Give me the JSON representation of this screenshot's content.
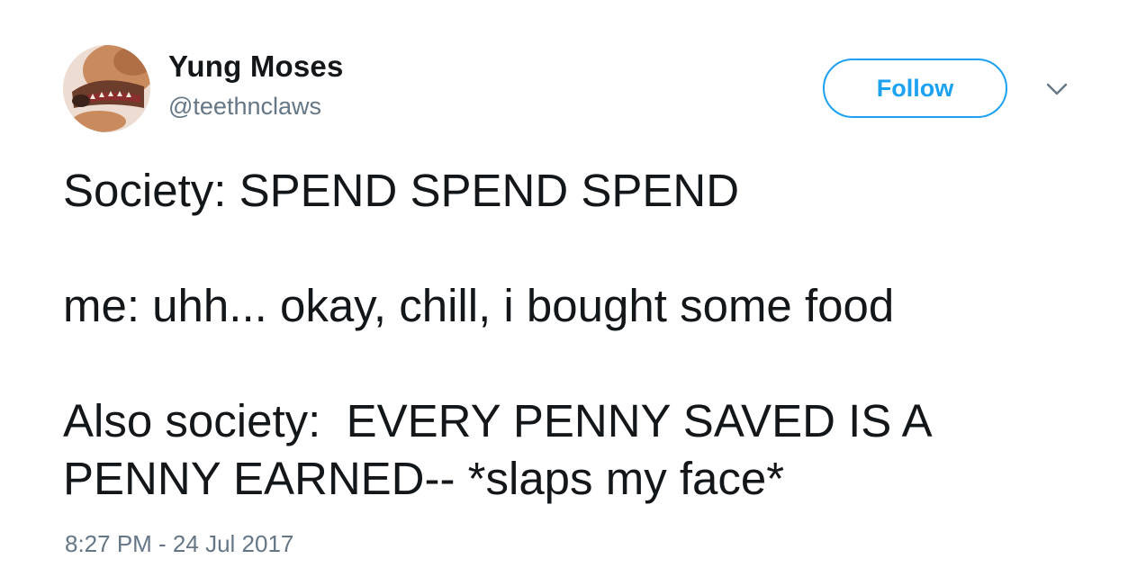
{
  "author": {
    "display_name": "Yung Moses",
    "username": "@teethnclaws",
    "avatar_icon": "dog-avatar"
  },
  "follow_button": {
    "label": "Follow"
  },
  "menu": {
    "icon": "chevron-down-icon"
  },
  "tweet": {
    "text": "Society: SPEND SPEND SPEND\n\nme: uhh... okay, chill, i bought some food\n\nAlso society:  EVERY PENNY SAVED IS A PENNY EARNED-- *slaps my face*",
    "timestamp": "8:27 PM - 24 Jul 2017"
  },
  "colors": {
    "accent": "#1da1f2",
    "text": "#14171a",
    "secondary_text": "#657786",
    "background": "#ffffff"
  }
}
